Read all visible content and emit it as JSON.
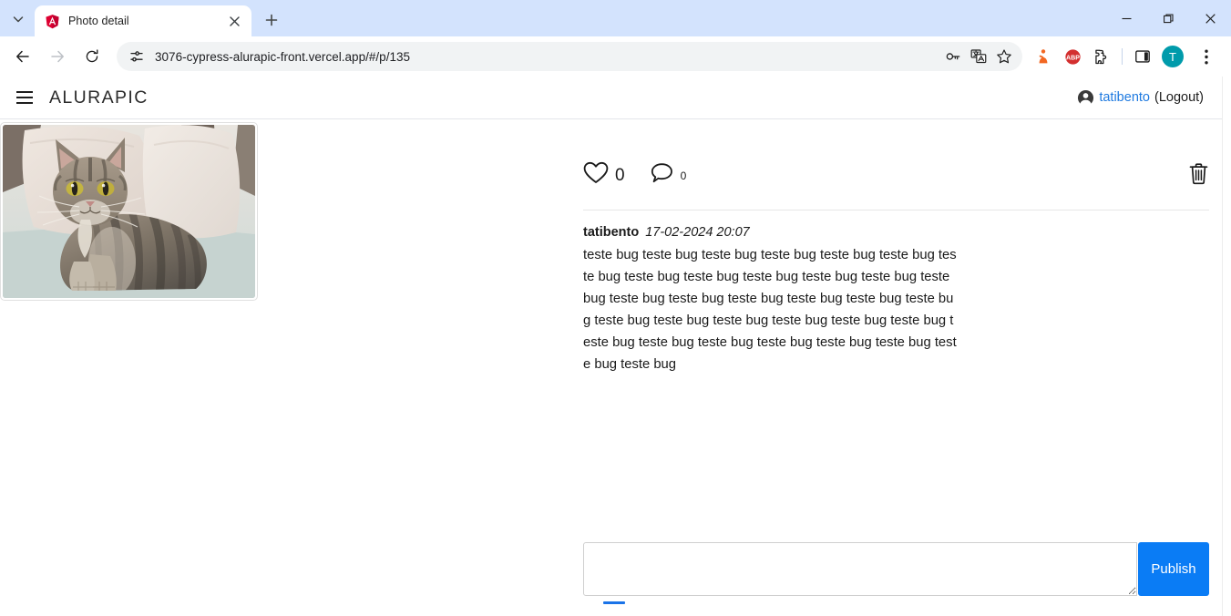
{
  "browser": {
    "tab": {
      "title": "Photo detail",
      "favicon": "angular-logo-icon",
      "close_label": "×"
    },
    "new_tab_label": "+",
    "tab_search_name": "tab-search-icon",
    "window_controls": {
      "minimize": "minimize-icon",
      "maximize": "maximize-icon",
      "close": "close-icon"
    },
    "nav": {
      "back": "back-arrow-icon",
      "forward": "forward-arrow-icon",
      "reload": "reload-icon"
    },
    "omnibox": {
      "url": "3076-cypress-alurapic-front.vercel.app/#/p/135",
      "placeholder": "Search Google or type a URL",
      "site_info_icon": "site-settings-icon",
      "actions": [
        {
          "name": "password-manager-icon"
        },
        {
          "name": "translate-icon"
        },
        {
          "name": "bookmark-star-icon"
        }
      ]
    },
    "extensions": [
      {
        "name": "extension-orange-icon",
        "color": "#f26722"
      },
      {
        "name": "adblock-plus-icon",
        "label": "ABP",
        "color": "#d32f2f"
      },
      {
        "name": "extensions-puzzle-icon"
      }
    ],
    "side_panel_icon": "side-panel-icon",
    "profile": {
      "name": "profile-avatar",
      "initial": "T",
      "color": "#009bab"
    },
    "menu_icon": "three-dot-menu-icon"
  },
  "app": {
    "header": {
      "menu_icon": "hamburger-menu-icon",
      "brand": "ALURAPIC",
      "user_icon": "account-circle-icon",
      "user_name": "tatibento",
      "logout_label": "(Logout)"
    },
    "photo": {
      "alt": "tabby cat lying on a light couch with pillows"
    },
    "actions": {
      "like_icon": "heart-outline-icon",
      "like_count": "0",
      "comment_icon": "comment-bubble-icon",
      "comment_count": "0",
      "delete_icon": "trash-bin-icon"
    },
    "comments": [
      {
        "author": "tatibento",
        "date": "17-02-2024 20:07",
        "text": "teste bug teste bug teste bug teste bug teste bug teste bug teste bug teste bug teste bug teste bug teste bug teste bug teste bug teste bug teste bug teste bug teste bug teste bug teste bug teste bug teste bug teste bug teste bug teste bug teste bug teste bug teste bug teste bug teste bug teste bug teste bug teste bug teste bug"
      }
    ],
    "composer": {
      "value": "",
      "placeholder": "",
      "publish_label": "Publish"
    }
  },
  "colors": {
    "accent_blue": "#0a7cf5",
    "link_blue": "#1f7ae0",
    "chrome_bg": "#d3e3fd",
    "omnibox_bg": "#f1f3f4"
  }
}
